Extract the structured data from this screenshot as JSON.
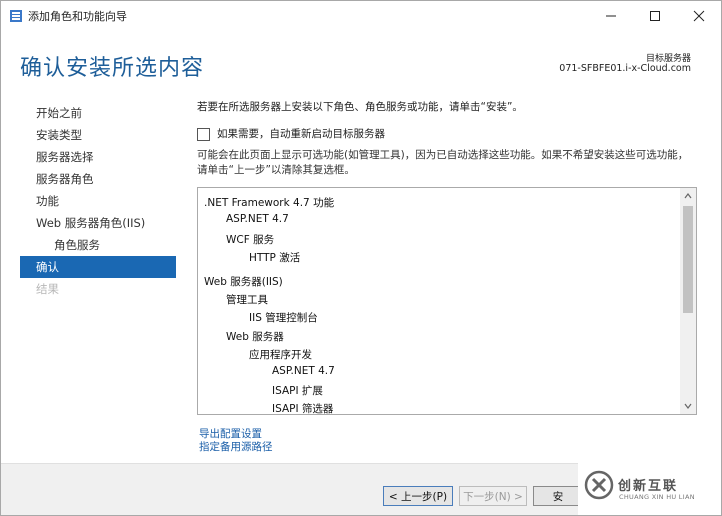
{
  "window": {
    "title": "添加角色和功能向导",
    "icon": "server-manager-icon"
  },
  "header": {
    "title": "确认安装所选内容",
    "target_label": "目标服务器",
    "target_value": "071-SFBFE01.i-x-Cloud.com"
  },
  "nav": {
    "items": [
      {
        "label": "开始之前"
      },
      {
        "label": "安装类型"
      },
      {
        "label": "服务器选择"
      },
      {
        "label": "服务器角色"
      },
      {
        "label": "功能"
      },
      {
        "label": "Web 服务器角色(IIS)"
      },
      {
        "label": "角色服务"
      },
      {
        "label": "确认"
      },
      {
        "label": "结果"
      }
    ]
  },
  "main": {
    "intro": "若要在所选服务器上安装以下角色、角色服务或功能，请单击“安装”。",
    "restart_checkbox": {
      "label": "如果需要，自动重新启动目标服务器",
      "checked": false
    },
    "note": "可能会在此页面上显示可选功能(如管理工具)，因为已自动选择这些功能。如果不希望安装这些可选功能，请单击“上一步”以清除其复选框。",
    "features": [
      {
        "label": ".NET Framework 4.7 功能"
      },
      {
        "label": "ASP.NET 4.7"
      },
      {
        "label": "WCF 服务"
      },
      {
        "label": "HTTP 激活"
      },
      {
        "label": "Web 服务器(IIS)"
      },
      {
        "label": "管理工具"
      },
      {
        "label": "IIS 管理控制台"
      },
      {
        "label": "Web 服务器"
      },
      {
        "label": "应用程序开发"
      },
      {
        "label": "ASP.NET 4.7"
      },
      {
        "label": "ISAPI 扩展"
      },
      {
        "label": "ISAPI 筛选器"
      }
    ],
    "links": {
      "export": "导出配置设置",
      "alternate_source": "指定备用源路径"
    }
  },
  "footer": {
    "prev": "< 上一步(P)",
    "next": "下一步(N) >",
    "install": "安"
  },
  "watermark": {
    "text": "创新互联",
    "sub": "CHUANG XIN HU LIAN"
  },
  "colors": {
    "accent": "#1a68b3",
    "title": "#1e5e99",
    "link": "#1a5ea8"
  }
}
